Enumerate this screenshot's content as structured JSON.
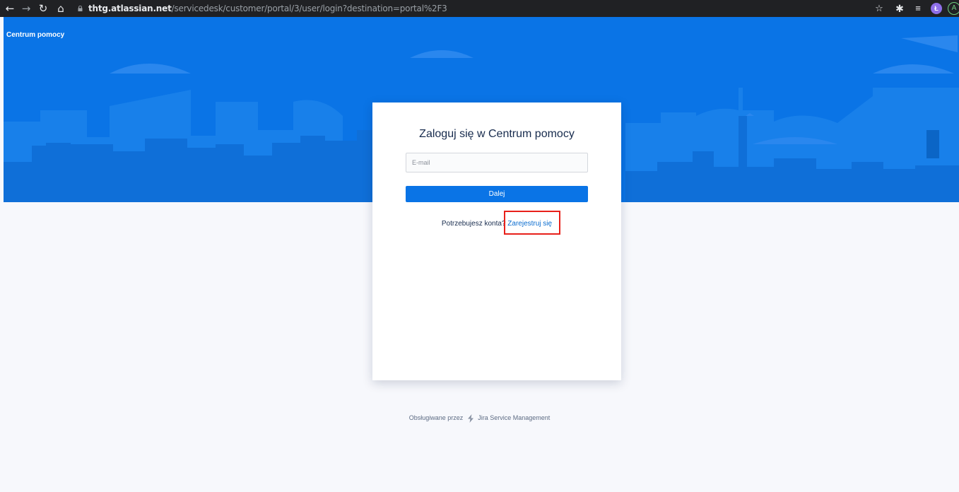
{
  "browser": {
    "url_domain": "thtg.atlassian.net",
    "url_path": "/servicedesk/customer/portal/3/user/login?destination=portal%2F3",
    "profile_initial": "Ł",
    "account_initial": "A"
  },
  "portal": {
    "name": "Centrum pomocy"
  },
  "login": {
    "title": "Zaloguj się w Centrum pomocy",
    "email_placeholder": "E-mail",
    "email_value": "",
    "submit_label": "Dalej",
    "signup_prompt": "Potrzebujesz konta?",
    "signup_link": "Zarejestruj się"
  },
  "footer": {
    "powered_prefix": "Obsługiwane przez",
    "powered_product": "Jira Service Management"
  },
  "colors": {
    "brand_blue": "#0a74e6",
    "highlight_red": "#e8201a",
    "link_blue": "#0a6ccf"
  }
}
